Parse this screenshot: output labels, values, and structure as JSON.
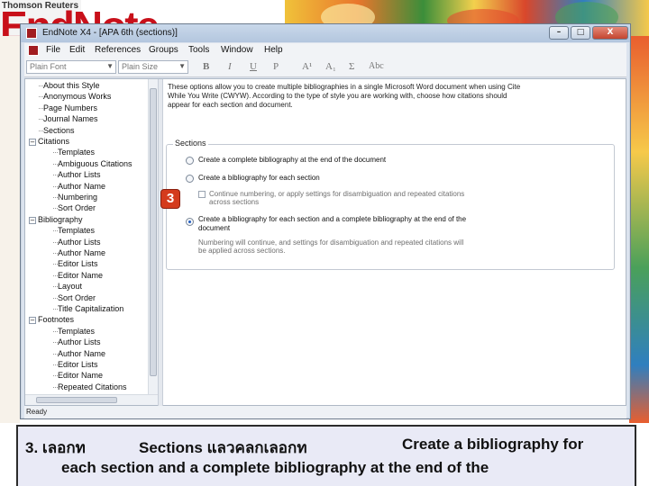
{
  "banner": {
    "brand": "Thomson Reuters",
    "brand_logo_text": "EndNote"
  },
  "window": {
    "title": "EndNote X4 - [APA 6th (sections)]",
    "controls": [
      "–",
      "□",
      "X"
    ]
  },
  "menu": [
    "File",
    "Edit",
    "References",
    "Groups",
    "Tools",
    "Window",
    "Help"
  ],
  "toolbar": {
    "font_combo": "Plain Font",
    "size_combo": "Plain Size",
    "bold": "B",
    "italic": "I",
    "underline": "U",
    "plain": "P",
    "superscript": "A¹",
    "subscript": "A₁",
    "symbol": "Σ",
    "case": "Abc"
  },
  "tree": [
    {
      "label": "About this Style",
      "level": 1
    },
    {
      "label": "Anonymous Works",
      "level": 1
    },
    {
      "label": "Page Numbers",
      "level": 1
    },
    {
      "label": "Journal Names",
      "level": 1
    },
    {
      "label": "Sections",
      "level": 1
    },
    {
      "label": "Citations",
      "level": 0,
      "toggle": "−"
    },
    {
      "label": "Templates",
      "level": 2
    },
    {
      "label": "Ambiguous Citations",
      "level": 2
    },
    {
      "label": "Author Lists",
      "level": 2
    },
    {
      "label": "Author Name",
      "level": 2
    },
    {
      "label": "Numbering",
      "level": 2
    },
    {
      "label": "Sort Order",
      "level": 2
    },
    {
      "label": "Bibliography",
      "level": 0,
      "toggle": "−"
    },
    {
      "label": "Templates",
      "level": 2
    },
    {
      "label": "Author Lists",
      "level": 2
    },
    {
      "label": "Author Name",
      "level": 2
    },
    {
      "label": "Editor Lists",
      "level": 2
    },
    {
      "label": "Editor Name",
      "level": 2
    },
    {
      "label": "Layout",
      "level": 2
    },
    {
      "label": "Sort Order",
      "level": 2
    },
    {
      "label": "Title Capitalization",
      "level": 2
    },
    {
      "label": "Footnotes",
      "level": 0,
      "toggle": "−"
    },
    {
      "label": "Templates",
      "level": 2
    },
    {
      "label": "Author Lists",
      "level": 2
    },
    {
      "label": "Author Name",
      "level": 2
    },
    {
      "label": "Editor Lists",
      "level": 2
    },
    {
      "label": "Editor Name",
      "level": 2
    },
    {
      "label": "Repeated Citations",
      "level": 2
    },
    {
      "label": "Title Capitalization",
      "level": 2
    }
  ],
  "pane": {
    "description": "These options allow you to create multiple bibliographies in a single Microsoft Word document when using Cite While You Write (CWYW). According to the type of style you are working with, choose how citations should appear for each section and document.",
    "group_label": "Sections",
    "options": [
      {
        "label": "Create a complete bibliography at the end of the document",
        "selected": false
      },
      {
        "label": "Create a bibliography for each section",
        "selected": false
      },
      {
        "label": "Create a bibliography for each section and a complete bibliography at the end of the document",
        "selected": true
      }
    ],
    "checkbox_label": "Continue numbering, or apply settings for disambiguation and repeated citations across sections",
    "note": "Numbering will continue, and settings for disambiguation and repeated citations will be applied across sections."
  },
  "marker": "3",
  "status": "Ready",
  "caption": {
    "line1_a": "3. เลอกท",
    "line1_b": "Sections แลวคลกเลอกท",
    "line1_c": "Create a bibliography for",
    "line2": "each section and a complete bibliography at the end of the"
  }
}
